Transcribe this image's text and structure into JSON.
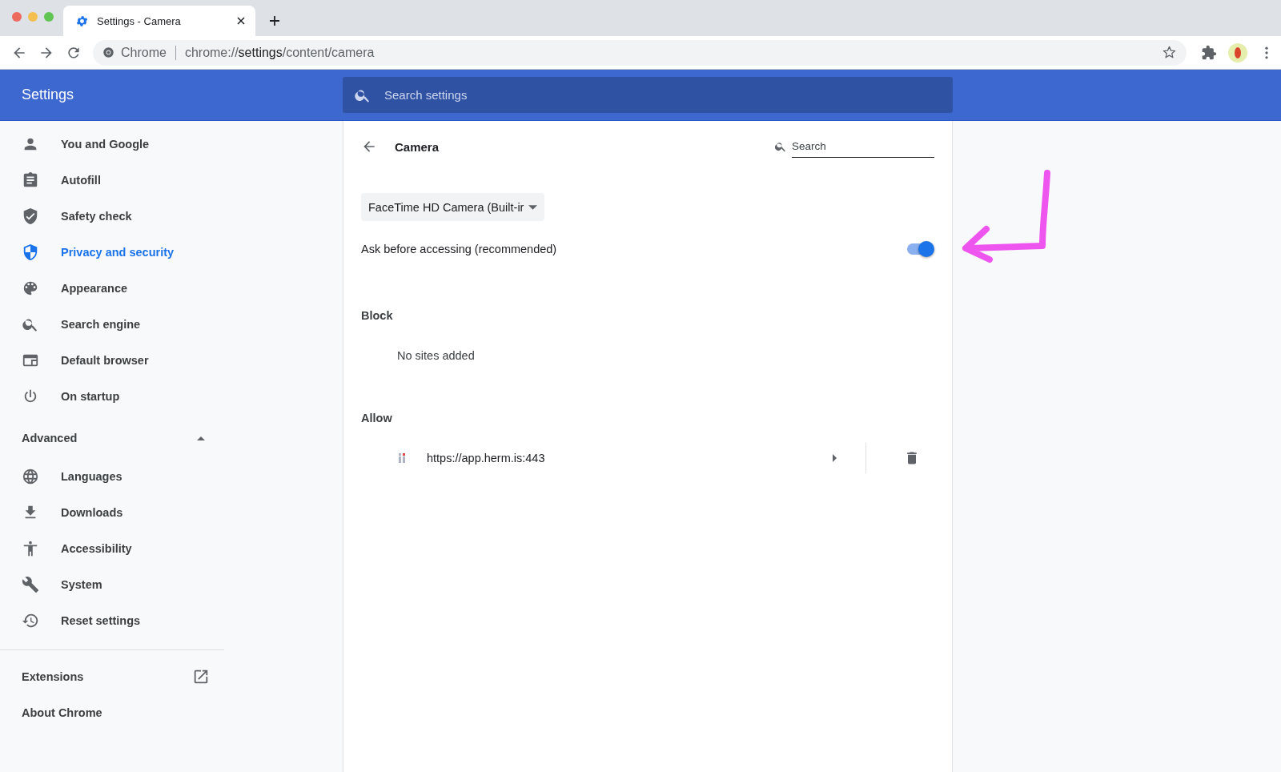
{
  "browser": {
    "tab": {
      "title": "Settings - Camera",
      "selected": true
    },
    "address_bar": {
      "origin": "Chrome",
      "url": "chrome://**settings**/content/camera"
    }
  },
  "header": {
    "title": "Settings",
    "search": {
      "placeholder": "Search settings"
    }
  },
  "sidebar": {
    "items": [
      {
        "label": "You and Google",
        "selected": false
      },
      {
        "label": "Autofill",
        "selected": false
      },
      {
        "label": "Safety check",
        "selected": false
      },
      {
        "label": "Privacy and security",
        "selected": true
      },
      {
        "label": "Appearance",
        "selected": false
      },
      {
        "label": "Search engine",
        "selected": false
      },
      {
        "label": "Default browser",
        "selected": false
      },
      {
        "label": "On startup",
        "selected": false
      }
    ],
    "advanced": {
      "label": "Advanced",
      "expanded": true,
      "items": [
        {
          "label": "Languages",
          "selected": false
        },
        {
          "label": "Downloads",
          "selected": false
        },
        {
          "label": "Accessibility",
          "selected": false
        },
        {
          "label": "System",
          "selected": false
        },
        {
          "label": "Reset settings",
          "selected": false
        }
      ]
    },
    "footer_items": [
      {
        "label": "Extensions",
        "external": true
      },
      {
        "label": "About Chrome",
        "external": false
      }
    ]
  },
  "content": {
    "title": "Camera",
    "search": {
      "placeholder": "Search"
    },
    "device_select": {
      "value": "FaceTime HD Camera (Built-ir"
    },
    "ask_toggle": {
      "label": "Ask before accessing (recommended)",
      "on": true
    },
    "sections": [
      {
        "title": "Block",
        "empty_text": "No sites added"
      },
      {
        "title": "Allow",
        "sites": [
          {
            "url": "https://app.herm.is:443"
          }
        ]
      }
    ]
  }
}
